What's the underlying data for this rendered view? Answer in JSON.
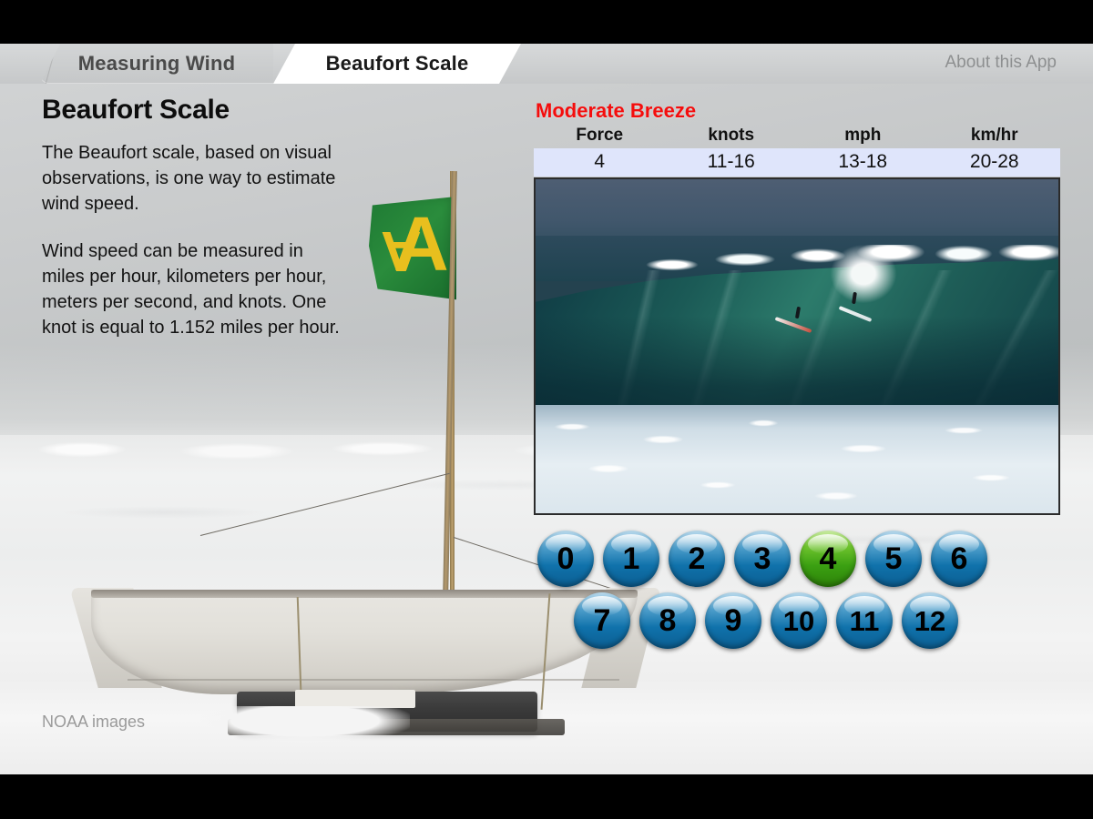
{
  "header": {
    "tabs": [
      {
        "label": "Measuring Wind",
        "active": false
      },
      {
        "label": "Beaufort Scale",
        "active": true
      }
    ],
    "about_label": "About this App"
  },
  "left_panel": {
    "title": "Beaufort Scale",
    "paragraph_1": "The Beaufort scale, based on visual observations, is one way to estimate wind speed.",
    "paragraph_2": "Wind speed can be measured in miles per hour, kilometers per hour, meters per second, and knots. One knot is equal to 1.152 miles per hour."
  },
  "right_panel": {
    "condition_name": "Moderate Breeze",
    "condition_color": "#f40d0d",
    "table": {
      "headers": [
        "Force",
        "knots",
        "mph",
        "km/hr"
      ],
      "row": [
        "4",
        "11-16",
        "13-18",
        "20-28"
      ],
      "row_background": "#dfe5fb"
    },
    "photo_alt": "surfers-riding-large-breaking-wave"
  },
  "force_buttons": {
    "selected": "4",
    "selected_color": "#3ba012",
    "default_color": "#1072ab",
    "row_1": [
      "0",
      "1",
      "2",
      "3",
      "4",
      "5",
      "6"
    ],
    "row_2": [
      "7",
      "8",
      "9",
      "10",
      "11",
      "12"
    ]
  },
  "background": {
    "credit": "NOAA images",
    "scene_alt": "beached-wooden-boat-with-green-flag-on-snow"
  }
}
